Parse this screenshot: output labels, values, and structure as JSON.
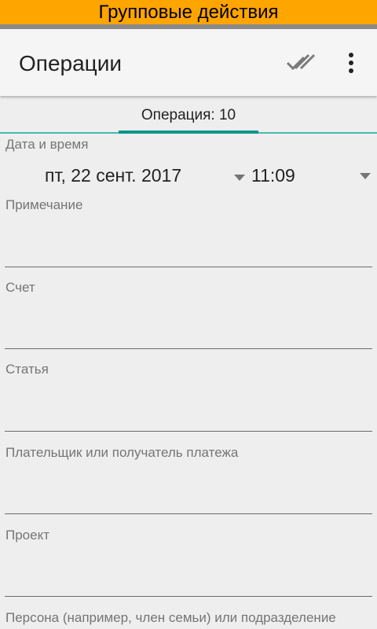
{
  "banner": {
    "text": "Групповые действия"
  },
  "toolbar": {
    "title": "Операции",
    "actions": {
      "select_all_icon": "double-check-icon",
      "more_icon": "more-vert-icon"
    }
  },
  "tabs": [
    {
      "label": "Операция: 10",
      "selected": true
    }
  ],
  "form": {
    "datetime": {
      "label": "Дата и время",
      "date": "пт, 22 сент. 2017",
      "time": "11:09"
    },
    "note": {
      "label": "Примечание",
      "value": ""
    },
    "account": {
      "label": "Счет",
      "value": ""
    },
    "article": {
      "label": "Статья",
      "value": ""
    },
    "payer": {
      "label": "Плательщик или получатель платежа",
      "value": ""
    },
    "project": {
      "label": "Проект",
      "value": ""
    },
    "person": {
      "label": "Персона (например, член семьи) или подразделение"
    }
  },
  "colors": {
    "banner_bg": "#ffa500",
    "accent": "#009688",
    "background": "#eeeeee",
    "label": "#757575"
  }
}
